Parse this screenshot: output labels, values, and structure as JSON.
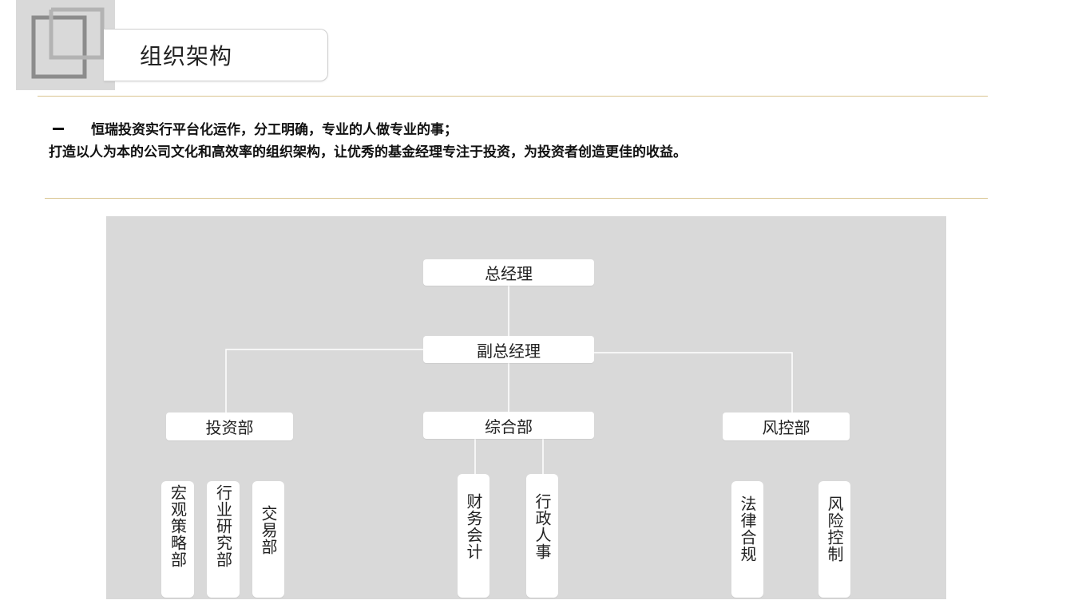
{
  "header": {
    "title": "组织架构"
  },
  "intro": {
    "line1": "恒瑞投资实行平台化运作，分工明确，专业的人做专业的事；",
    "line2": "打造以人为本的公司文化和高效率的组织架构，让优秀的基金经理专注于投资，为投资者创造更佳的收益。"
  },
  "org": {
    "ceo": "总经理",
    "deputy": "副总经理",
    "departments": {
      "investment": {
        "label": "投资部",
        "units": [
          "宏观策略部",
          "行业研究部",
          "交易部"
        ]
      },
      "general": {
        "label": "综合部",
        "units": [
          "财务会计",
          "行政人事"
        ]
      },
      "risk": {
        "label": "风控部",
        "units": [
          "法律合规",
          "风险控制"
        ]
      }
    }
  },
  "colors": {
    "rule": "#d9c490",
    "panel": "#d9d9d9",
    "node": "#ffffff"
  }
}
